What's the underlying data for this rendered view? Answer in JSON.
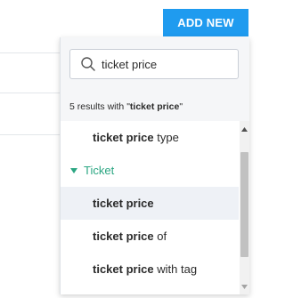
{
  "toolbar": {
    "add_new_label": "ADD NEW"
  },
  "search": {
    "value": "ticket price"
  },
  "results": {
    "prefix": "5 results with \"",
    "query": "ticket price",
    "suffix": "\""
  },
  "items": [
    {
      "bold": "ticket price",
      "rest": " type"
    },
    {
      "bold": "ticket price",
      "rest": ""
    },
    {
      "bold": "ticket price",
      "rest": " of"
    },
    {
      "bold": "ticket price",
      "rest": " with tag"
    }
  ],
  "group": {
    "label": "Ticket"
  },
  "colors": {
    "accent": "#1f9bef",
    "group_green": "#2ba682",
    "active_row": "#eef1f6"
  },
  "icons": {
    "search": "search-icon",
    "caret": "caret-down-icon",
    "scroll_up": "scroll-up-arrow-icon",
    "scroll_down": "scroll-down-arrow-icon"
  }
}
